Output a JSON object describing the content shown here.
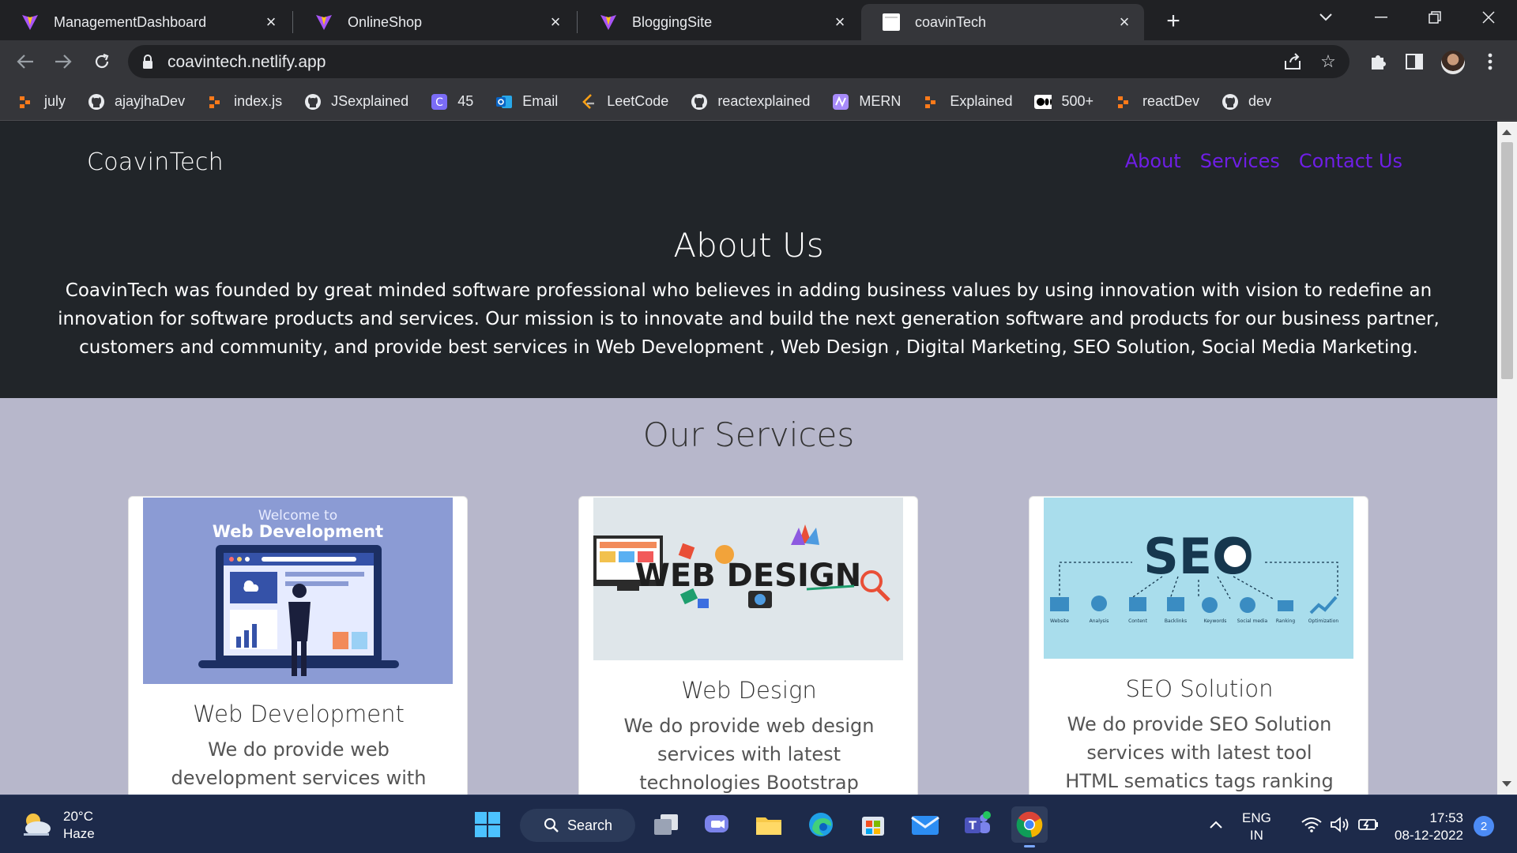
{
  "browser": {
    "tabs": [
      {
        "title": "ManagementDashboard",
        "active": false
      },
      {
        "title": "OnlineShop",
        "active": false
      },
      {
        "title": "BloggingSite",
        "active": false
      },
      {
        "title": "coavinTech",
        "active": true
      }
    ],
    "url": "coavintech.netlify.app",
    "bookmarks": [
      {
        "label": "july",
        "icon": "orange-dots-icon"
      },
      {
        "label": "ajayjhaDev",
        "icon": "github-icon"
      },
      {
        "label": "index.js",
        "icon": "orange-dots-icon"
      },
      {
        "label": "JSexplained",
        "icon": "github-icon"
      },
      {
        "label": "45",
        "icon": "c-badge-icon"
      },
      {
        "label": "Email",
        "icon": "outlook-icon"
      },
      {
        "label": "LeetCode",
        "icon": "leetcode-icon"
      },
      {
        "label": "reactexplained",
        "icon": "github-icon"
      },
      {
        "label": "MERN",
        "icon": "mern-icon"
      },
      {
        "label": "Explained",
        "icon": "orange-dots-icon"
      },
      {
        "label": "500+",
        "icon": "medium-icon"
      },
      {
        "label": "reactDev",
        "icon": "orange-dots-icon"
      },
      {
        "label": "dev",
        "icon": "github-icon"
      }
    ]
  },
  "site": {
    "brand": "CoavinTech",
    "nav": [
      "About",
      "Services",
      "Contact Us"
    ],
    "nav_color": "#6f1ee6",
    "about_title": "About Us",
    "about_text": "CoavinTech was founded by great minded software professional who believes in adding business values by using innovation with vision to redefine an innovation for software products and services. Our mission is to innovate and build the next generation software and products for our business partner, customers and community, and provide best services in Web Development , Web Design , Digital Marketing, SEO Solution, Social Media Marketing.",
    "services_title": "Our Services",
    "services": [
      {
        "title": "Web Development",
        "text": "We do provide web development services with",
        "image_caption_small": "Welcome to",
        "image_caption_big": "Web Development"
      },
      {
        "title": "Web Design",
        "text": "We do provide web design services with latest technologies Bootstrap",
        "image_caption_big": "WEB DESIGN"
      },
      {
        "title": "SEO Solution",
        "text": "We do provide SEO Solution services with latest tool HTML sematics tags ranking",
        "image_caption_big": "SEO",
        "seo_steps": [
          "Website",
          "Analysis",
          "Content",
          "Backlinks",
          "Keywords",
          "Social media",
          "Ranking",
          "Optimization"
        ]
      }
    ]
  },
  "taskbar": {
    "weather_temp": "20°C",
    "weather_desc": "Haze",
    "search_label": "Search",
    "lang_top": "ENG",
    "lang_bottom": "IN",
    "time": "17:53",
    "date": "08-12-2022",
    "notifications": "2"
  }
}
